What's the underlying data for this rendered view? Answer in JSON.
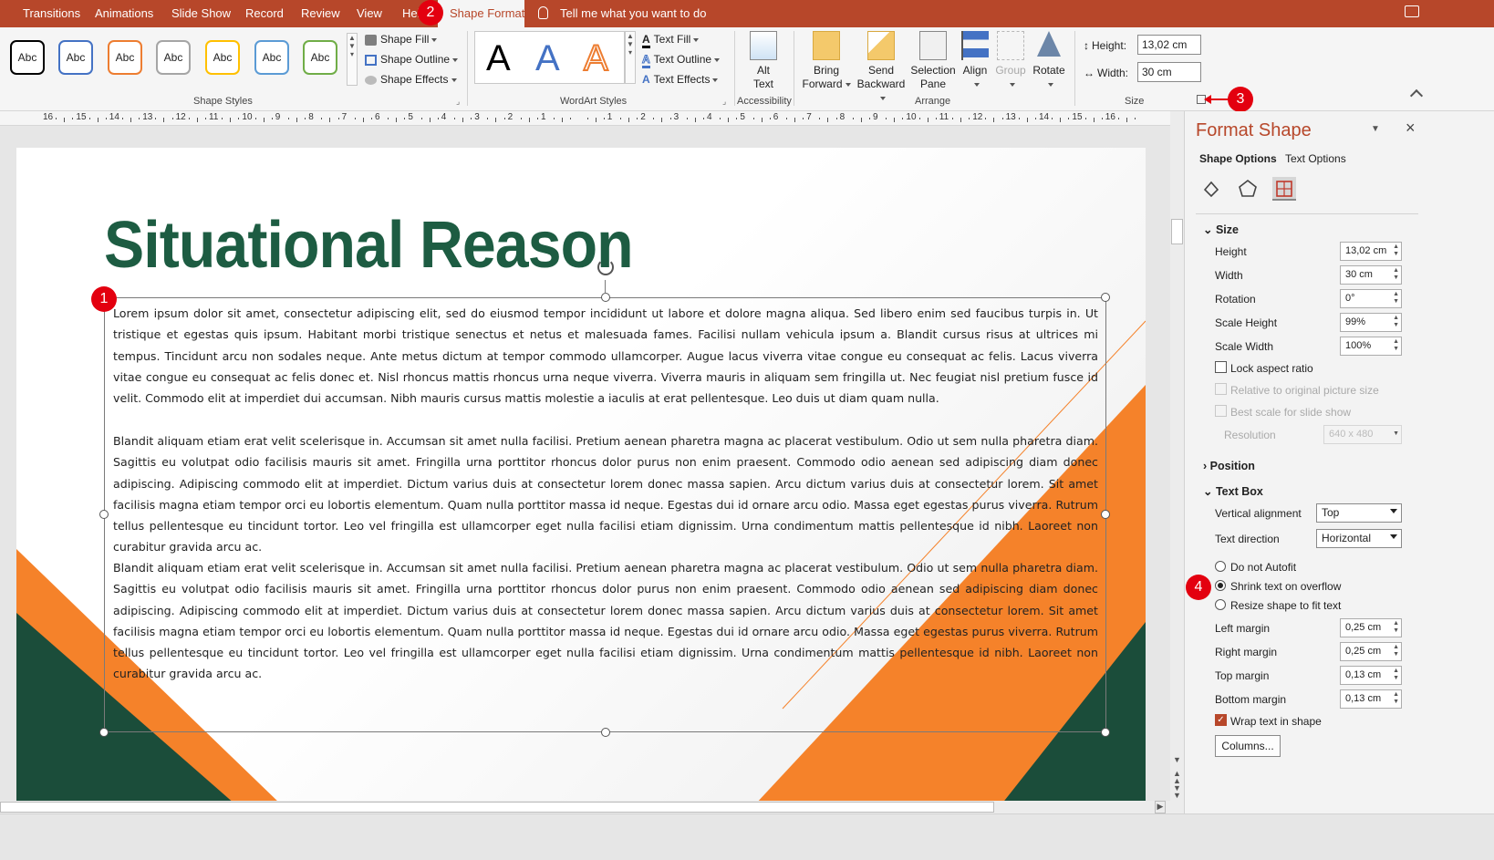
{
  "tabs": [
    {
      "label": "Transitions",
      "active": false
    },
    {
      "label": "Animations",
      "active": false
    },
    {
      "label": "Slide Show",
      "active": false
    },
    {
      "label": "Record",
      "active": false
    },
    {
      "label": "Review",
      "active": false
    },
    {
      "label": "View",
      "active": false
    },
    {
      "label": "Hel",
      "active": false
    },
    {
      "label": "Shape Format",
      "active": true
    }
  ],
  "tell_me": "Tell me what you want to do",
  "ribbon": {
    "shape_styles": {
      "swatch_label": "Abc",
      "swatch_colors": [
        "#000000",
        "#4472c4",
        "#ed7d31",
        "#a5a5a5",
        "#ffc000",
        "#5b9bd5",
        "#70ad47"
      ],
      "fill": "Shape Fill",
      "outline": "Shape Outline",
      "effects": "Shape Effects",
      "group": "Shape Styles"
    },
    "wordart": {
      "letter": "A",
      "colors": [
        "#000000",
        "#4472c4",
        "#ed7d31"
      ],
      "fill": "Text Fill",
      "outline": "Text Outline",
      "effects": "Text Effects",
      "group": "WordArt Styles"
    },
    "accessibility": {
      "alt_text_1": "Alt",
      "alt_text_2": "Text",
      "group": "Accessibility"
    },
    "arrange": {
      "bring_1": "Bring",
      "bring_2": "Forward",
      "send_1": "Send",
      "send_2": "Backward",
      "selection_1": "Selection",
      "selection_2": "Pane",
      "align": "Align",
      "group_btn": "Group",
      "rotate": "Rotate",
      "group": "Arrange"
    },
    "size": {
      "height_label": "Height:",
      "height_value": "13,02 cm",
      "width_label": "Width:",
      "width_value": "30 cm",
      "group": "Size"
    }
  },
  "ruler": [
    "16",
    "15",
    "14",
    "13",
    "12",
    "11",
    "10",
    "9",
    "8",
    "7",
    "6",
    "5",
    "4",
    "3",
    "2",
    "1",
    "",
    "1",
    "2",
    "3",
    "4",
    "5",
    "6",
    "7",
    "8",
    "9",
    "10",
    "11",
    "12",
    "13",
    "14",
    "15",
    "16"
  ],
  "slide": {
    "title": "Situational Reason",
    "paragraphs": [
      "Lorem ipsum dolor sit amet, consectetur adipiscing elit, sed do eiusmod tempor incididunt ut labore et dolore magna aliqua. Sed libero enim sed faucibus turpis in. Ut tristique et egestas quis ipsum. Habitant morbi tristique senectus et netus et malesuada fames. Facilisi nullam vehicula ipsum a. Blandit cursus risus at ultrices mi tempus. Tincidunt arcu non sodales neque. Ante metus dictum at tempor commodo ullamcorper. Augue lacus viverra vitae congue eu consequat ac felis. Lacus viverra vitae congue eu consequat ac felis donec et. Nisl rhoncus mattis rhoncus urna neque viverra. Viverra mauris in aliquam sem fringilla ut. Nec feugiat nisl pretium fusce id velit. Commodo elit at imperdiet dui accumsan. Nibh mauris cursus mattis molestie a iaculis at erat pellentesque. Leo duis ut diam quam nulla.",
      "Blandit aliquam etiam erat velit scelerisque in. Accumsan sit amet nulla facilisi. Pretium aenean pharetra magna ac placerat vestibulum. Odio ut sem nulla pharetra diam. Sagittis eu volutpat odio facilisis mauris sit amet. Fringilla urna porttitor rhoncus dolor purus non enim praesent. Commodo odio aenean sed adipiscing diam donec adipiscing. Adipiscing commodo elit at imperdiet. Dictum varius duis at consectetur lorem donec massa sapien. Arcu dictum varius duis at consectetur lorem. Sit amet facilisis magna etiam tempor orci eu lobortis elementum. Quam nulla porttitor massa id neque. Egestas dui id ornare arcu odio. Massa eget egestas purus viverra. Rutrum tellus pellentesque eu tincidunt tortor. Leo vel fringilla est ullamcorper eget nulla facilisi etiam dignissim. Urna condimentum mattis pellentesque id nibh. Laoreet non curabitur gravida arcu ac.",
      "Blandit aliquam etiam erat velit scelerisque in. Accumsan sit amet nulla facilisi. Pretium aenean pharetra magna ac placerat vestibulum. Odio ut sem nulla pharetra diam. Sagittis eu volutpat odio facilisis mauris sit amet. Fringilla urna porttitor rhoncus dolor purus non enim praesent. Commodo odio aenean sed adipiscing diam donec adipiscing. Adipiscing commodo elit at imperdiet. Dictum varius duis at consectetur lorem donec massa sapien. Arcu dictum varius duis at consectetur lorem. Sit amet facilisis magna etiam tempor orci eu lobortis elementum. Quam nulla porttitor massa id neque. Egestas dui id ornare arcu odio. Massa eget egestas purus viverra. Rutrum tellus pellentesque eu tincidunt tortor. Leo vel fringilla est ullamcorper eget nulla facilisi etiam dignissim. Urna condimentum mattis pellentesque id nibh. Laoreet non curabitur gravida arcu ac."
    ]
  },
  "callouts": [
    "1",
    "2",
    "3",
    "4"
  ],
  "pane": {
    "title": "Format Shape",
    "tabs": [
      "Shape Options",
      "Text Options"
    ],
    "size_section": "Size",
    "fields": [
      {
        "label": "Height",
        "value": "13,02 cm"
      },
      {
        "label": "Width",
        "value": "30 cm"
      },
      {
        "label": "Rotation",
        "value": "0°"
      },
      {
        "label": "Scale Height",
        "value": "99%"
      },
      {
        "label": "Scale Width",
        "value": "100%"
      }
    ],
    "lock_aspect": "Lock aspect ratio",
    "relative": "Relative to original picture size",
    "best_scale": "Best scale for slide show",
    "resolution_label": "Resolution",
    "resolution_value": "640 x 480",
    "position_section": "Position",
    "textbox_section": "Text Box",
    "valign_label": "Vertical alignment",
    "valign_value": "Top",
    "tdir_label": "Text direction",
    "tdir_value": "Horizontal",
    "autofit": [
      "Do not Autofit",
      "Shrink text on overflow",
      "Resize shape to fit text"
    ],
    "autofit_selected": 1,
    "margins": [
      {
        "label": "Left margin",
        "value": "0,25 cm"
      },
      {
        "label": "Right margin",
        "value": "0,25 cm"
      },
      {
        "label": "Top margin",
        "value": "0,13 cm"
      },
      {
        "label": "Bottom margin",
        "value": "0,13 cm"
      }
    ],
    "wrap": "Wrap text in shape",
    "columns": "Columns..."
  },
  "colors": {
    "accent": "#b7472a",
    "title_green": "#1d5c42",
    "orange": "#f5822a",
    "dark_green": "#1b4d3a",
    "callout_red": "#e3000f"
  }
}
